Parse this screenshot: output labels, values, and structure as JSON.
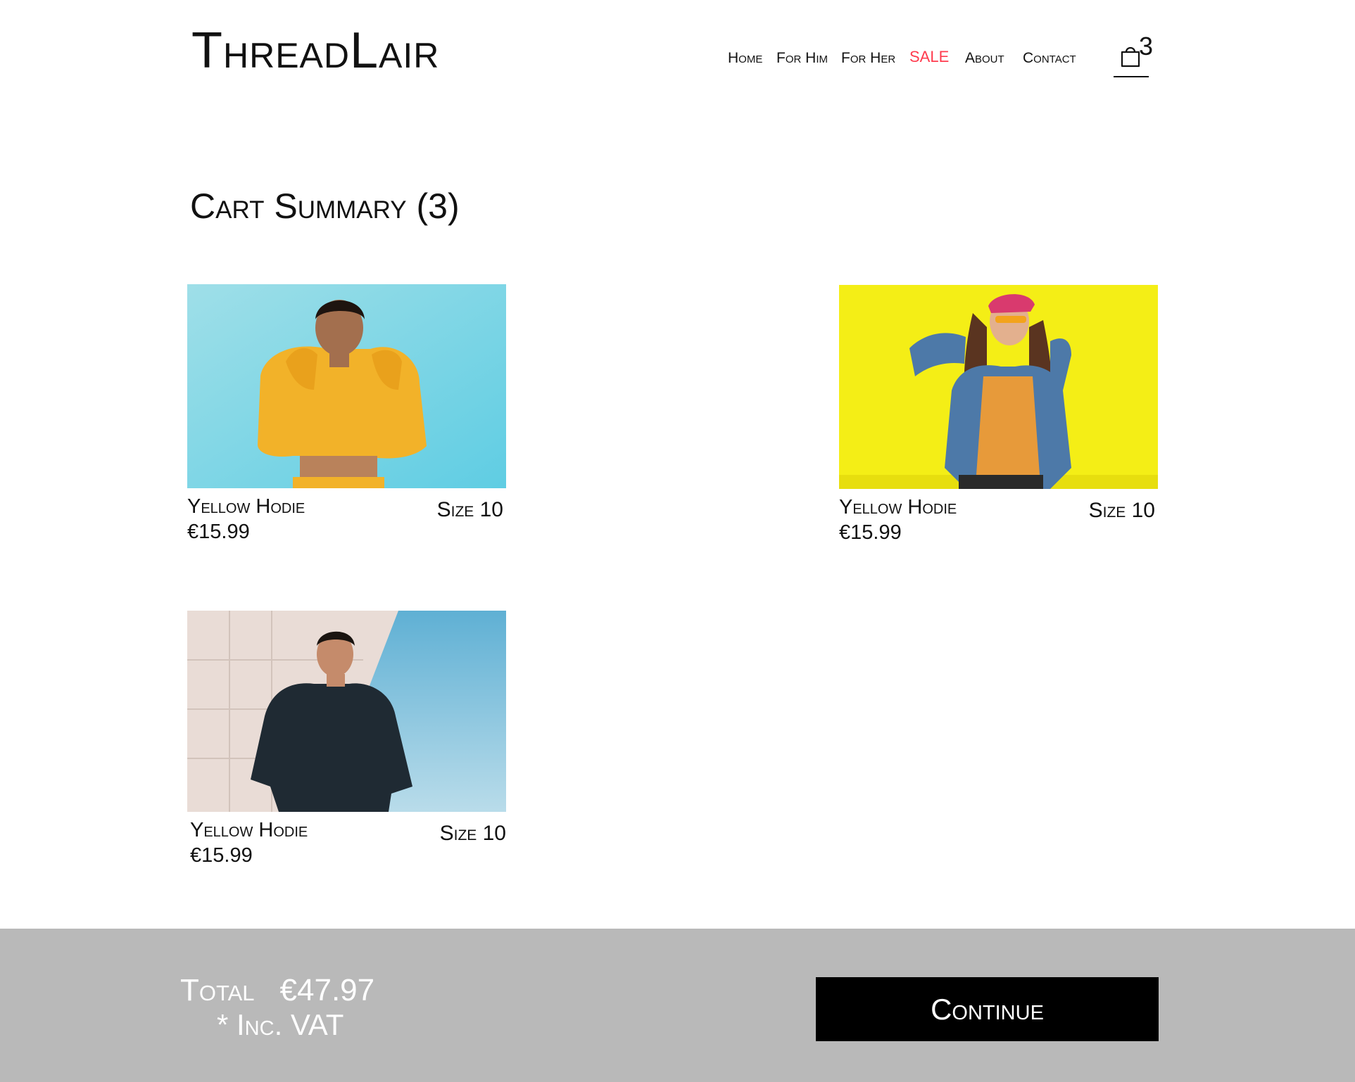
{
  "brand": {
    "logo": "ThreadLair"
  },
  "nav": {
    "items": [
      {
        "label": "Home"
      },
      {
        "label": "For Him"
      },
      {
        "label": "For Her"
      },
      {
        "label": "SALE"
      },
      {
        "label": "About"
      },
      {
        "label": "Contact"
      }
    ],
    "cart_count": "3",
    "cart_icon": "shopping-bag-icon"
  },
  "page": {
    "title": "Cart Summary (3)"
  },
  "cart": {
    "items": [
      {
        "name": "Yellow Hodie",
        "price": "€15.99",
        "size": "Size 10",
        "image": "woman-yellow-hoodie-blue-sky"
      },
      {
        "name": "Yellow Hodie",
        "price": "€15.99",
        "size": "Size 10",
        "image": "woman-denim-jacket-yellow-wall"
      },
      {
        "name": "Yellow Hodie",
        "price": "€15.99",
        "size": "Size 10",
        "image": "man-dark-shirt-blue-sky"
      }
    ]
  },
  "footer": {
    "total_label": "Total",
    "total_value": "€47.97",
    "vat_note": "* Inc. VAT",
    "continue_label": "Continue"
  },
  "colors": {
    "sale": "#ff3b4e",
    "footer_bg": "#b9b9b9",
    "button_bg": "#000000",
    "button_text": "#ffffff"
  }
}
